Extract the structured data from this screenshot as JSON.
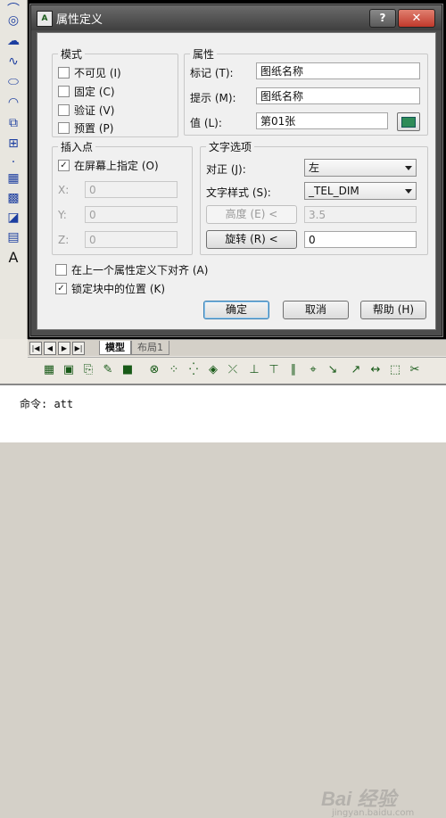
{
  "dialog": {
    "title": "属性定义",
    "help_glyph": "?",
    "close_glyph": "✕",
    "mode": {
      "title": "模式",
      "options": [
        {
          "label": "不可见 (I)",
          "checked": false
        },
        {
          "label": "固定 (C)",
          "checked": false
        },
        {
          "label": "验证 (V)",
          "checked": false
        },
        {
          "label": "预置 (P)",
          "checked": false
        }
      ]
    },
    "attribute": {
      "title": "属性",
      "tag_label": "标记 (T):",
      "tag_value": "图纸名称",
      "prompt_label": "提示 (M):",
      "prompt_value": "图纸名称",
      "default_label": "值 (L):",
      "default_value": "第01张"
    },
    "insertion": {
      "title": "插入点",
      "specify_label": "在屏幕上指定 (O)",
      "specify_checked": true,
      "x_label": "X:",
      "x_value": "0",
      "y_label": "Y:",
      "y_value": "0",
      "z_label": "Z:",
      "z_value": "0"
    },
    "text_options": {
      "title": "文字选项",
      "justify_label": "对正 (J):",
      "justify_value": "左",
      "style_label": "文字样式 (S):",
      "style_value": "_TEL_DIM",
      "height_button": "高度 (E) <",
      "height_value": "3.5",
      "rotation_button": "旋转 (R) <",
      "rotation_value": "0"
    },
    "align_below_label": "在上一个属性定义下对齐 (A)",
    "align_below_checked": false,
    "lock_position_label": "锁定块中的位置 (K)",
    "lock_position_checked": true,
    "ok_label": "确定",
    "cancel_label": "取消",
    "help_label": "帮助 (H)"
  },
  "layout_tabs": [
    "模型",
    "布局1"
  ],
  "command_line": "命令: att",
  "watermark": "Bai 经验",
  "watermark_sub": "jingyan.baidu.com",
  "colors": {
    "title_bar": "#4c4c4c",
    "close_button": "#c0392b",
    "drawing_bg": "#000000",
    "marker": "#d040d0"
  }
}
